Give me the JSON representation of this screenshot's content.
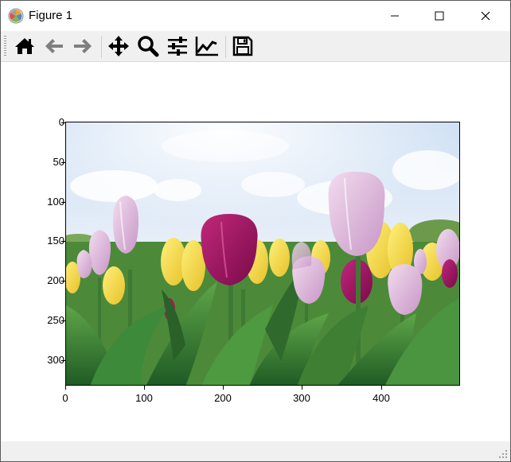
{
  "window": {
    "title": "Figure 1",
    "controls": [
      "minimize",
      "maximize",
      "close"
    ]
  },
  "toolbar": {
    "buttons": [
      {
        "name": "home",
        "icon": "home-icon"
      },
      {
        "name": "back",
        "icon": "arrow-left-icon"
      },
      {
        "name": "forward",
        "icon": "arrow-right-icon"
      },
      {
        "name": "pan",
        "icon": "move-icon"
      },
      {
        "name": "zoom",
        "icon": "magnifier-icon"
      },
      {
        "name": "subplots",
        "icon": "sliders-icon"
      },
      {
        "name": "customize",
        "icon": "line-chart-icon"
      },
      {
        "name": "save",
        "icon": "floppy-disk-icon"
      }
    ]
  },
  "axes": {
    "y_ticks": [
      "0",
      "50",
      "100",
      "150",
      "200",
      "250",
      "300"
    ],
    "x_ticks": [
      "0",
      "100",
      "200",
      "300",
      "400"
    ],
    "image_content": "tulip field photograph"
  },
  "colors": {
    "toolbar_bg": "#f0f0f0",
    "frame": "#000000"
  }
}
